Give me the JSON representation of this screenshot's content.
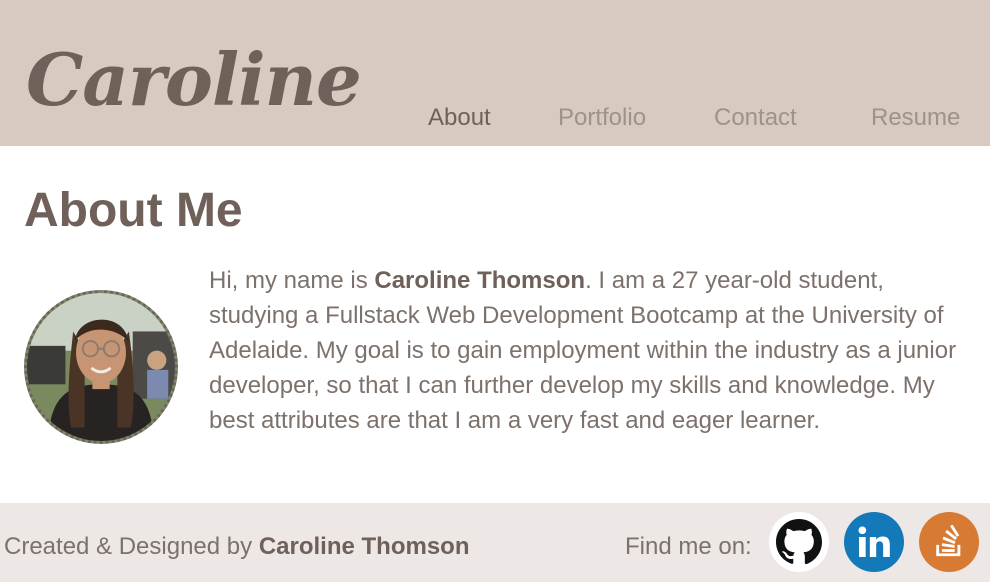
{
  "header": {
    "brand": "Caroline",
    "nav": [
      {
        "label": "About",
        "active": true
      },
      {
        "label": "Portfolio",
        "active": false
      },
      {
        "label": "Contact",
        "active": false
      },
      {
        "label": "Resume",
        "active": false
      }
    ]
  },
  "main": {
    "title": "About Me",
    "bio": {
      "intro": "Hi, my name is ",
      "name": "Caroline Thomson",
      "rest": ". I am a 27 year-old student, studying a Fullstack Web Development Bootcamp at the University of Adelaide. My goal is to gain employment within the industry as a junior developer, so that I can further develop my skills and knowledge. My best attributes are that I am a very fast and eager learner."
    }
  },
  "footer": {
    "credit_prefix": "Created & Designed by ",
    "credit_name": "Caroline Thomson",
    "find_me": "Find me on:",
    "social": [
      {
        "icon": "github-icon",
        "color": "#ffffff"
      },
      {
        "icon": "linkedin-icon",
        "color": "#1479b8"
      },
      {
        "icon": "stackoverflow-icon",
        "color": "#d77a33"
      }
    ]
  },
  "colors": {
    "header_bg": "#d8cac0",
    "footer_bg": "#ede7e5",
    "text_dark": "#6f615a",
    "nav_inactive": "#9d928c"
  }
}
